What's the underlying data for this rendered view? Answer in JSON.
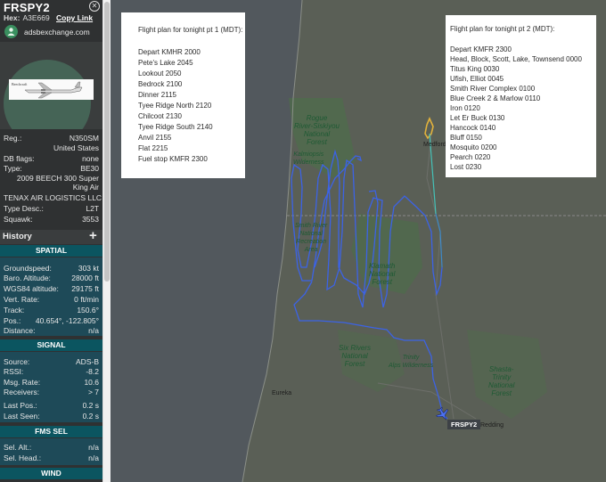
{
  "aircraft": {
    "callsign": "FRSPY2",
    "hex_label": "Hex:",
    "hex_value": "A3E669",
    "copy_link": "Copy Link",
    "source": "adsbexchange.com",
    "photo_caption": "Beechcraft"
  },
  "details": [
    {
      "k": "Reg.:",
      "v": "N350SM"
    },
    {
      "k": "",
      "v": "United States"
    },
    {
      "k": "DB flags:",
      "v": "none"
    },
    {
      "k": "Type:",
      "v": "BE30"
    },
    {
      "k": "2009 BEECH 300 Super King Air",
      "v": ""
    },
    {
      "k": "TENAX AIR LOGISTICS LLC",
      "v": ""
    },
    {
      "k": "Type Desc.:",
      "v": "L2T"
    },
    {
      "k": "Squawk:",
      "v": "3553"
    }
  ],
  "history_label": "History",
  "history_plus": "+",
  "sections": {
    "spatial": "SPATIAL",
    "signal": "SIGNAL",
    "fms": "FMS SEL",
    "wind": "WIND"
  },
  "spatial": [
    {
      "k": "Groundspeed:",
      "v": "303 kt"
    },
    {
      "k": "Baro. Altitude:",
      "v": "28000 ft"
    },
    {
      "k": "WGS84 altitude:",
      "v": "29175 ft"
    },
    {
      "k": "Vert. Rate:",
      "v": "0 ft/min"
    },
    {
      "k": "Track:",
      "v": "150.6°"
    },
    {
      "k": "Pos.:",
      "v": "40.654°, -122.805°"
    },
    {
      "k": "Distance:",
      "v": "n/a"
    }
  ],
  "signal": [
    {
      "k": "Source:",
      "v": "ADS-B"
    },
    {
      "k": "RSSI:",
      "v": "-8.2"
    },
    {
      "k": "Msg. Rate:",
      "v": "10.6"
    },
    {
      "k": "Receivers:",
      "v": "> 7"
    },
    {
      "k": "Last Pos.:",
      "v": "0.2 s"
    },
    {
      "k": "Last Seen:",
      "v": "0.2 s"
    }
  ],
  "fms": [
    {
      "k": "Sel. Alt.:",
      "v": "n/a"
    },
    {
      "k": "Sel. Head.:",
      "v": "n/a"
    }
  ],
  "map": {
    "labels": {
      "rogue": "Rogue\nRiver-Siskiyou\nNational\nForest",
      "kalmiopsis": "Kalmiopsis\nWilderness",
      "smith": "Smith River\nNational\nRecreation\nArea",
      "klamath": "Klamath\nNational\nForest",
      "six_rivers": "Six Rivers\nNational\nForest",
      "trinity_alps": "Trinity\nAlps Wilderness",
      "shasta": "Shasta-\nTrinity\nNational\nForest",
      "medford": "Medford",
      "eureka": "Eureka",
      "redding": "Redding"
    },
    "aircraft_tag": "FRSPY2"
  },
  "plan1": {
    "title": "Flight plan for tonight pt 1 (MDT):",
    "lines": [
      "Depart KMHR 2000",
      "Pete's Lake 2045",
      "Lookout 2050",
      "Bedrock 2100",
      "Dinner 2115",
      "Tyee Ridge North 2120",
      "Chilcoot 2130",
      "Tyee Ridge South 2140",
      "Anvil 2155",
      "Flat 2215",
      "Fuel stop KMFR 2300"
    ]
  },
  "plan2": {
    "title": "Flight plan for tonight pt 2 (MDT):",
    "lines": [
      "Depart KMFR 2300",
      "Head, Block, Scott, Lake, Townsend 0000",
      "Titus King 0030",
      "Ufish, Elliot 0045",
      "Smith River Complex 0100",
      "Blue Creek 2 & Marlow 0110",
      "Iron 0120",
      "Let Er Buck 0130",
      "Hancock 0140",
      "Bluff 0150",
      "Mosquito 0200",
      "Pearch 0220",
      "Lost 0230"
    ]
  }
}
